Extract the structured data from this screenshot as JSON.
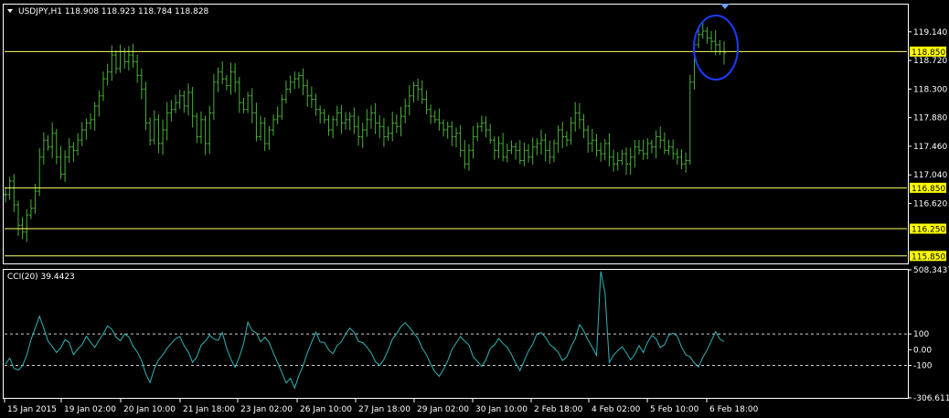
{
  "window": {
    "header_text": "USDJPY,H1  118.908 118.923 118.784 118.828",
    "menu_glyph": "triangle-down-icon"
  },
  "colors": {
    "background": "#000000",
    "grid_frame": "#ffffff",
    "bar": "#4CAF3A",
    "level_line": "#ffff66",
    "level_label_bg": "#ffff00",
    "cci_line": "#2fb5b5",
    "highlight_ellipse": "#1a3cff",
    "marker": "#6fa0ff"
  },
  "chart_data": [
    {
      "type": "bar",
      "title": "USDJPY,H1",
      "ohlc_readout": {
        "open": 118.908,
        "high": 118.923,
        "low": 118.784,
        "close": 118.828
      },
      "y_ticks": [
        "119.140",
        "118.720",
        "118.300",
        "117.880",
        "117.460",
        "117.040",
        "116.620"
      ],
      "ylim": [
        115.74,
        119.54
      ],
      "x_ticks": [
        "15 Jan 2015",
        "19 Jan 02:00",
        "20 Jan 10:00",
        "21 Jan 18:00",
        "23 Jan 02:00",
        "26 Jan 10:00",
        "27 Jan 18:00",
        "29 Jan 02:00",
        "30 Jan 10:00",
        "2 Feb 18:00",
        "4 Feb 02:00",
        "5 Feb 10:00",
        "6 Feb 18:00"
      ],
      "horizontal_levels": [
        {
          "value": 118.85,
          "label": "118.850"
        },
        {
          "value": 116.85,
          "label": "116.850"
        },
        {
          "value": 116.25,
          "label": "116.250"
        },
        {
          "value": 115.85,
          "label": "115.850"
        }
      ],
      "close_trace": [
        [
          116.75,
          116.95,
          116.6,
          116.3,
          116.2,
          116.45,
          116.55,
          116.8,
          117.3,
          117.55,
          117.45,
          117.65,
          117.3,
          117.05,
          117.3,
          117.45,
          117.4,
          117.55,
          117.7,
          117.8,
          117.85,
          118.05,
          118.2,
          118.45,
          118.55,
          118.8,
          118.6,
          118.85,
          118.7,
          118.8,
          118.7,
          118.5,
          118.3,
          117.8
        ],
        [
          117.55,
          117.85,
          117.5,
          117.7,
          117.95,
          118.0,
          118.1,
          118.2,
          118.05,
          118.25,
          117.9,
          117.6,
          117.85,
          117.5,
          117.95,
          118.4,
          118.55,
          118.45,
          118.35,
          118.55,
          118.4,
          118.1,
          118.0,
          118.2,
          117.95,
          117.6,
          117.8,
          117.5,
          117.7,
          117.85,
          117.9,
          118.15,
          118.3,
          118.4
        ],
        [
          118.45,
          118.5,
          118.35,
          118.2,
          118.15,
          118.0,
          117.95,
          117.85,
          117.7,
          117.85,
          117.95,
          117.8,
          117.85,
          117.9,
          117.75,
          117.6,
          117.7,
          117.85,
          117.95,
          117.8,
          117.75,
          117.6,
          117.65,
          117.8,
          117.75,
          117.9,
          118.05,
          118.2,
          118.35,
          118.3,
          118.15,
          118.0,
          117.9,
          117.85
        ],
        [
          117.8,
          117.7,
          117.75,
          117.6,
          117.65,
          117.4,
          117.2,
          117.4,
          117.6,
          117.75,
          117.8,
          117.7,
          117.55,
          117.4,
          117.5,
          117.3,
          117.4,
          117.45,
          117.4,
          117.25,
          117.4,
          117.3,
          117.45,
          117.5,
          117.55,
          117.4,
          117.3,
          117.5,
          117.7,
          117.6,
          117.55,
          117.8,
          117.95,
          117.85
        ],
        [
          117.7,
          117.5,
          117.55,
          117.4,
          117.35,
          117.5,
          117.3,
          117.2,
          117.25,
          117.35,
          117.2,
          117.3,
          117.45,
          117.4,
          117.35,
          117.5,
          117.45,
          117.6,
          117.55,
          117.4,
          117.45,
          117.35,
          117.3,
          117.2,
          117.25,
          118.4,
          118.95,
          119.1,
          119.15,
          119.05,
          119.0,
          118.95,
          118.85,
          118.83
        ]
      ]
    },
    {
      "type": "line",
      "title": "CCI(20) 39.4423",
      "series": [
        {
          "name": "CCI(20)",
          "last_value": 39.4423
        }
      ],
      "y_ticks": [
        "508.3437",
        "100",
        "0.00",
        "-100",
        "-306.6117"
      ],
      "ylim": [
        -306.6117,
        508.3437
      ],
      "reference_levels": [
        100,
        -100
      ],
      "trace": [
        [
          -100,
          -60,
          -120,
          -140,
          -90,
          -30,
          60,
          150,
          210,
          140,
          60,
          10,
          -20,
          20,
          60,
          40,
          -20,
          10,
          40,
          90,
          60,
          20,
          60,
          100,
          150,
          120,
          90,
          60,
          110,
          90,
          30,
          -10,
          -60,
          -150
        ],
        [
          -200,
          -120,
          -60,
          -40,
          10,
          40,
          60,
          80,
          30,
          -20,
          -80,
          -40,
          20,
          60,
          90,
          70,
          60,
          100,
          20,
          -60,
          -110,
          -40,
          30,
          170,
          130,
          100,
          60,
          80,
          40,
          -10,
          -80,
          -140,
          -200,
          -180
        ],
        [
          -250,
          -160,
          -90,
          -20,
          50,
          110,
          60,
          40,
          0,
          -30,
          20,
          60,
          90,
          130,
          100,
          60,
          50,
          20,
          -30,
          -80,
          -110,
          -60,
          0,
          60,
          110,
          140,
          170,
          140,
          110,
          70,
          20,
          -30,
          -90,
          -130
        ],
        [
          -170,
          -120,
          -60,
          -10,
          40,
          90,
          60,
          20,
          -40,
          -80,
          -110,
          -60,
          0,
          40,
          80,
          50,
          10,
          -40,
          -90,
          -120,
          -60,
          0,
          40,
          90,
          120,
          90,
          40,
          10,
          -20,
          -60,
          -40,
          20,
          80,
          160
        ],
        [
          130,
          60,
          10,
          -40,
          -80,
          -120,
          -90,
          -40,
          -10,
          30,
          -10,
          -60,
          -30,
          20,
          -20,
          40,
          80,
          60,
          20,
          40,
          90,
          110,
          80,
          20,
          -30,
          -40,
          -80,
          -120,
          -60,
          10,
          60,
          120,
          60,
          40
        ]
      ]
    }
  ]
}
